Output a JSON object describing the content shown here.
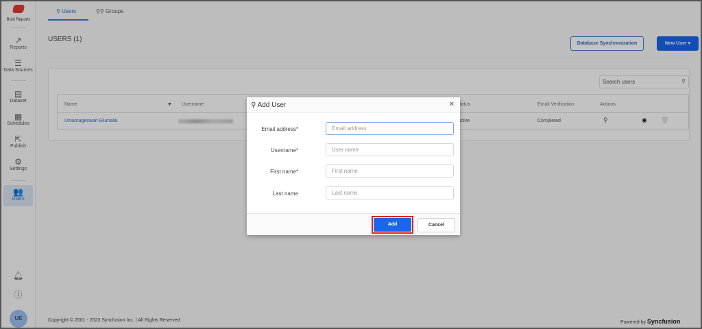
{
  "brand": {
    "name": "Bold Reports"
  },
  "sidebar": {
    "items": [
      {
        "label": "Reports",
        "icon": "trend-icon"
      },
      {
        "label": "Data Sources",
        "icon": "server-icon"
      },
      {
        "label": "Dataset",
        "icon": "dataset-icon"
      },
      {
        "label": "Schedules",
        "icon": "calendar-clock-icon"
      },
      {
        "label": "Publish",
        "icon": "publish-icon"
      },
      {
        "label": "Settings",
        "icon": "gear-icon"
      },
      {
        "label": "Users",
        "icon": "users-icon",
        "active": true
      }
    ],
    "avatar": "UE"
  },
  "tabs": [
    {
      "label": "Users",
      "active": true
    },
    {
      "label": "Groups"
    }
  ],
  "page": {
    "title": "USERS (1)",
    "db_sync": "Database Synchronization",
    "new_user": "New User ▾",
    "search_placeholder": "Search users"
  },
  "table": {
    "columns": [
      "Name",
      "Username",
      "Status",
      "Email Verification",
      "Actions"
    ],
    "rows": [
      {
        "name": "Umamageswari Elumalai",
        "status": "Active",
        "email_verification": "Completed"
      }
    ]
  },
  "footer": {
    "copyright": "Copyright © 2001 - 2023 Syncfusion Inc.  |  All Rights Reserved",
    "powered": "Powered by",
    "brand": "Syncfusion"
  },
  "dialog": {
    "title": "Add User",
    "fields": [
      {
        "label": "Email address*",
        "placeholder": "Email address"
      },
      {
        "label": "Username*",
        "placeholder": "User name"
      },
      {
        "label": "First name*",
        "placeholder": "First name"
      },
      {
        "label": "Last name",
        "placeholder": "Last name"
      }
    ],
    "add": "Add",
    "cancel": "Cancel"
  },
  "colors": {
    "accent": "#1a66f0",
    "highlight": "#e02020",
    "brand": "#e53935"
  }
}
